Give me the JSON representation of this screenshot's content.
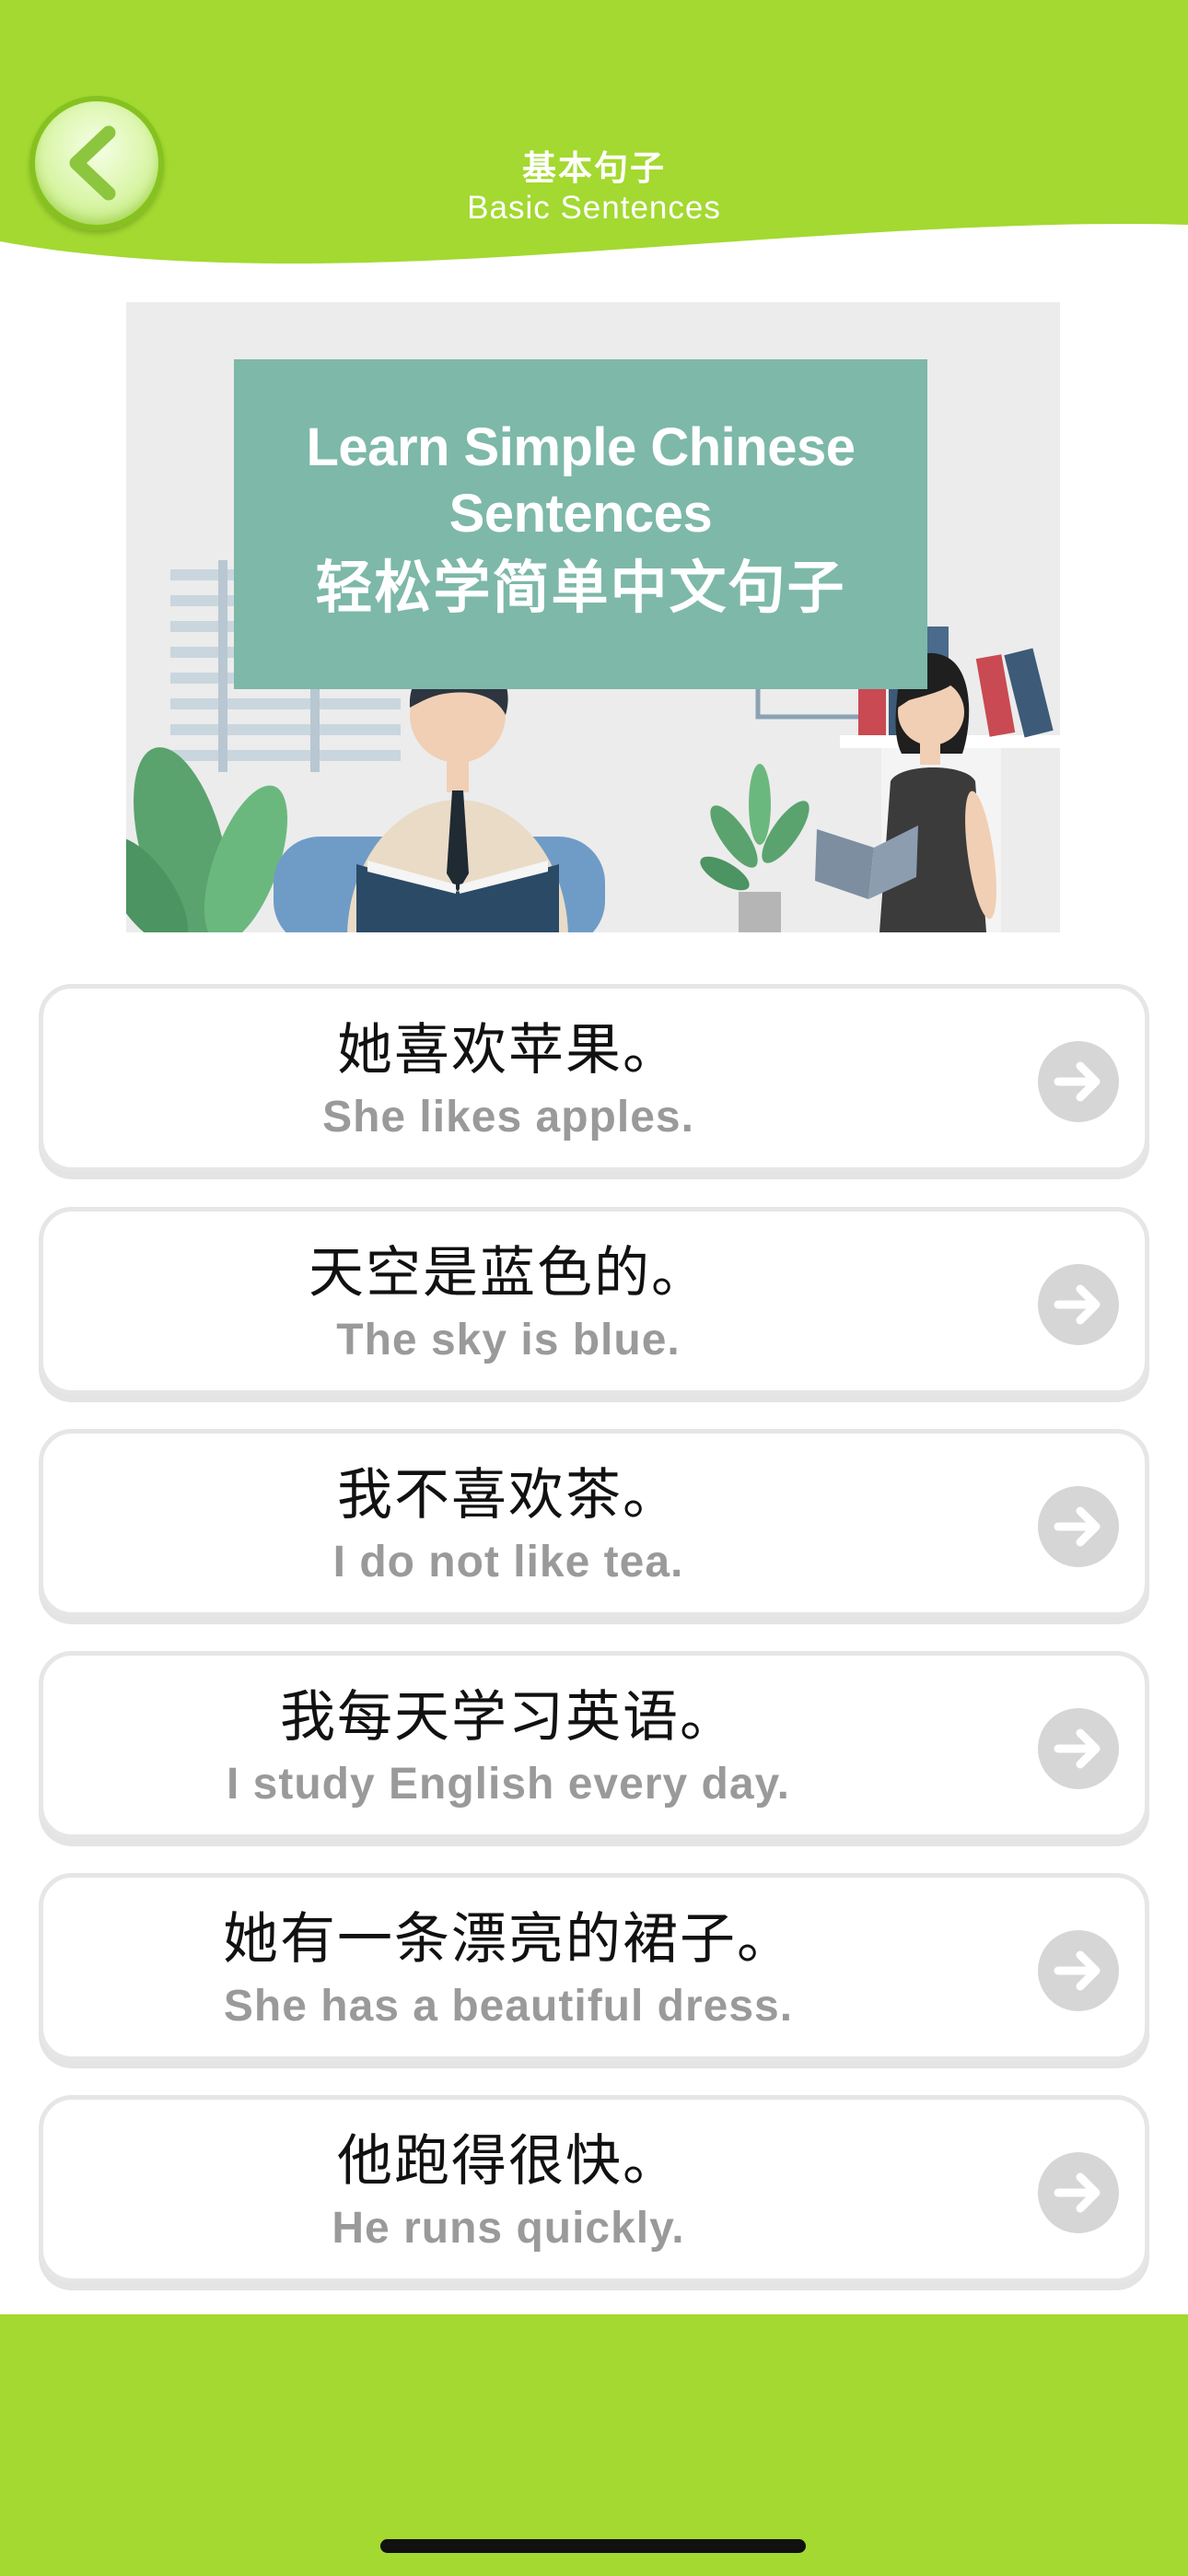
{
  "header": {
    "title_cn": "基本句子",
    "title_en": "Basic Sentences",
    "back_icon": "chevron-left-icon"
  },
  "banner": {
    "title_en": "Learn Simple Chinese Sentences",
    "title_cn": "轻松学简单中文句子"
  },
  "sentences": [
    {
      "cn": "她喜欢苹果。",
      "en": "She likes apples."
    },
    {
      "cn": "天空是蓝色的。",
      "en": "The sky is blue."
    },
    {
      "cn": "我不喜欢茶。",
      "en": "I do not like tea."
    },
    {
      "cn": "我每天学习英语。",
      "en": "I study English every day."
    },
    {
      "cn": "她有一条漂亮的裙子。",
      "en": "She has a beautiful dress."
    },
    {
      "cn": "他跑得很快。",
      "en": "He runs quickly."
    }
  ],
  "colors": {
    "accent_green": "#a3d930",
    "banner_panel": "#7db8a8",
    "english_text": "#9a9a9a",
    "arrow_circle": "#d6d6d6"
  },
  "icons": {
    "card_arrow": "arrow-right-icon"
  }
}
